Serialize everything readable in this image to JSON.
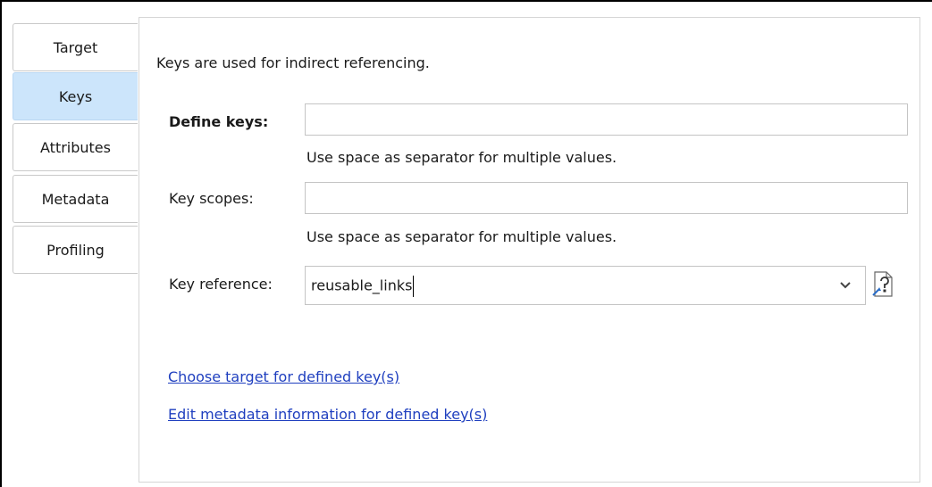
{
  "tabs": [
    {
      "label": "Target"
    },
    {
      "label": "Keys",
      "selected": true
    },
    {
      "label": "Attributes"
    },
    {
      "label": "Metadata"
    },
    {
      "label": "Profiling"
    }
  ],
  "panel": {
    "intro": "Keys are used for indirect referencing.",
    "define_keys": {
      "label": "Define keys:",
      "value": "",
      "hint": "Use space as separator for multiple values."
    },
    "key_scopes": {
      "label": "Key scopes:",
      "value": "",
      "hint": "Use space as separator for multiple values."
    },
    "key_reference": {
      "label": "Key reference:",
      "value": "reusable_links",
      "resolve_icon": "resolve-reference-icon",
      "dropdown_icon": "chevron-down-icon"
    },
    "links": [
      {
        "label": "Choose target for defined key(s)"
      },
      {
        "label": "Edit metadata information for defined key(s)"
      }
    ]
  },
  "colors": {
    "selected_tab": "#cce5fb",
    "link": "#1f3fbf",
    "border": "#c4c4c4"
  }
}
